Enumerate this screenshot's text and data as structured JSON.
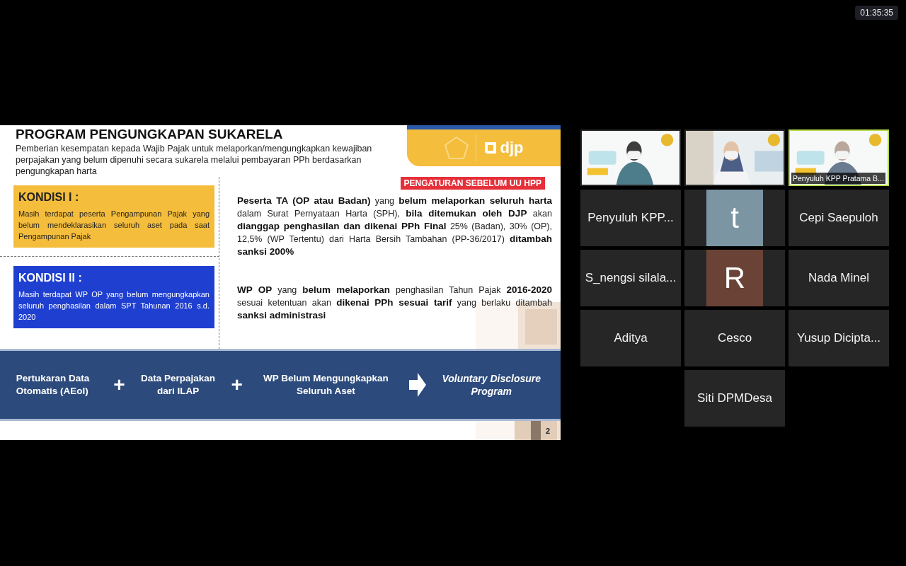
{
  "clock": "01:35:35",
  "slide": {
    "title": "PROGRAM PENGUNGKAPAN SUKARELA",
    "subtitle": "Pemberian kesempatan kepada Wajib Pajak untuk melaporkan/mengungkapkan kewajiban perpajakan yang belum dipenuhi secara sukarela melalui pembayaran PPh berdasarkan pengungkapan harta",
    "logo_text": "djp",
    "badge": "PENGATURAN SEBELUM UU HPP",
    "conditions": [
      {
        "title": "KONDISI I :",
        "text": "Masih terdapat peserta Pengampunan Pajak yang belum mendeklarasikan seluruh aset pada saat Pengampunan Pajak",
        "color": "#f5bd3c"
      },
      {
        "title": "KONDISI II :",
        "text": "Masih terdapat WP OP yang belum mengungkapkan seluruh penghasilan dalam SPT Tahunan 2016 s.d. 2020",
        "color": "#1f3fd0"
      }
    ],
    "descriptions": [
      "**Peserta TA (OP atau Badan)** yang **belum melaporkan seluruh harta** dalam Surat Pernyataan Harta (SPH), **bila ditemukan oleh DJP** akan **dianggap penghasilan dan dikenai PPh Final** 25% (Badan), 30% (OP), 12,5% (WP Tertentu) dari Harta Bersih Tambahan (PP-36/2017) **ditambah sanksi 200%**",
      "**WP OP** yang **belum melaporkan** penghasilan Tahun Pajak **2016-2020** sesuai ketentuan akan **dikenai PPh sesuai tarif** yang berlaku ditambah **sanksi administrasi**"
    ],
    "flow": [
      {
        "kind": "term",
        "text": "Pertukaran Data Otomatis (AEoI)"
      },
      {
        "kind": "plus",
        "text": "+"
      },
      {
        "kind": "term",
        "text": "Data Perpajakan dari ILAP"
      },
      {
        "kind": "plus",
        "text": "+"
      },
      {
        "kind": "term",
        "text": "WP Belum Mengungkapkan Seluruh Aset"
      },
      {
        "kind": "arrow"
      },
      {
        "kind": "result",
        "text": "Voluntary Disclosure Program"
      }
    ],
    "page_number": "2"
  },
  "participants": [
    {
      "kind": "video",
      "speaking": false
    },
    {
      "kind": "video",
      "speaking": false
    },
    {
      "kind": "video",
      "speaking": true,
      "name": "Penyuluh KPP Pratama B..."
    },
    {
      "kind": "name",
      "name": "Penyuluh KPP..."
    },
    {
      "kind": "avatar",
      "initial": "t",
      "color": "#7b95a3"
    },
    {
      "kind": "name",
      "name": "Cepi Saepuloh"
    },
    {
      "kind": "name",
      "name": "S_nengsi silala..."
    },
    {
      "kind": "avatar",
      "initial": "R",
      "color": "#6b4336"
    },
    {
      "kind": "name",
      "name": "Nada Minel"
    },
    {
      "kind": "name",
      "name": "Aditya"
    },
    {
      "kind": "name",
      "name": "Cesco"
    },
    {
      "kind": "name",
      "name": "Yusup Dicipta..."
    },
    {
      "kind": "name",
      "name": "Siti DPMDesa"
    }
  ]
}
